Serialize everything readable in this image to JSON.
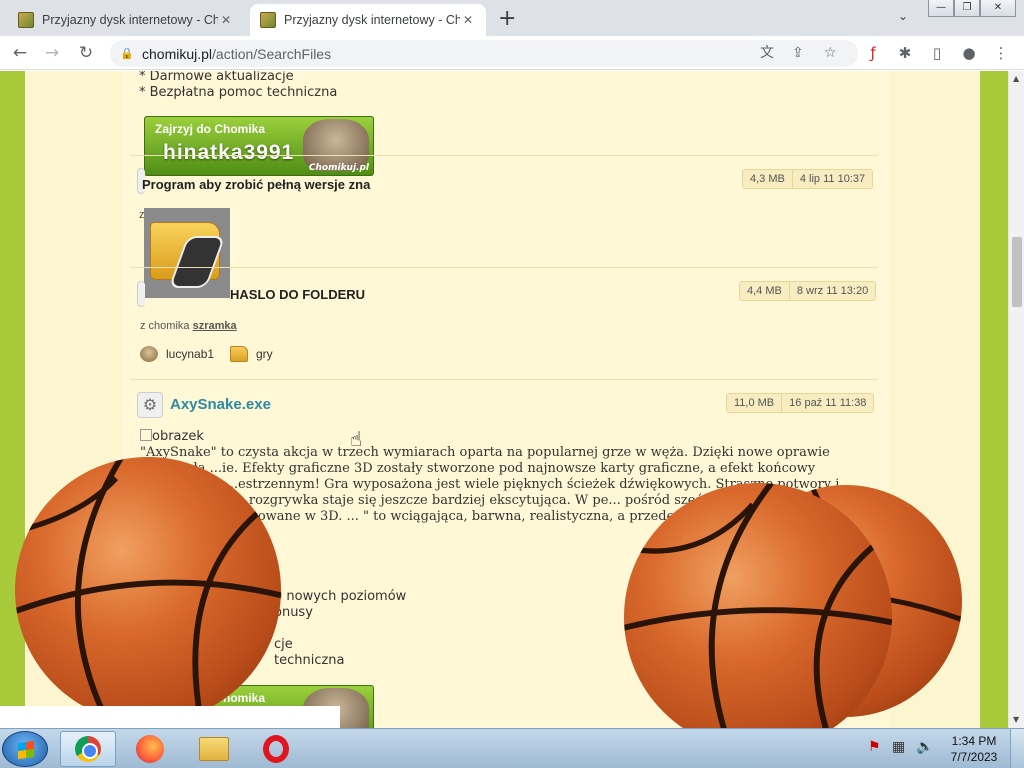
{
  "browser": {
    "tabs": [
      {
        "title": "Przyjazny dysk internetowy - Chomikuj.pl",
        "active": false
      },
      {
        "title": "Przyjazny dysk internetowy - Chomikuj.pl",
        "active": true
      }
    ],
    "new_tab_label": "+",
    "url_host": "chomikuj.pl",
    "url_path": "/action/SearchFiles",
    "window_controls": [
      "minimize",
      "restore",
      "close"
    ]
  },
  "page": {
    "top_lines": [
      "* Darmowe aktualizacje",
      "* Bezpłatna pomoc techniczna"
    ],
    "banner": {
      "line1": "Zajrzyj do Chomika",
      "user": "hinatka3991",
      "brand": "Chomikuj.pl"
    },
    "results": [
      {
        "title": "Program aby zrobić pełną wersje zna",
        "size": "4,3 MB",
        "date": "4 lip 11 10:37"
      },
      {
        "title": "HASLO DO FOLDERU",
        "size": "4,4 MB",
        "date": "8 wrz 11 13:20",
        "from_label": "z chomika",
        "from_user": "szramka",
        "crumb_user": "lucynab1",
        "crumb_folder": "gry"
      },
      {
        "title": "AxySnake.exe",
        "size": "11,0 MB",
        "date": "16 paź 11 11:38",
        "image_alt": "obrazek",
        "description": "\"AxySnake\" to czysta akcja w trzech wymiarach oparta na popularnej grze w węża. Dzięki nowe oprawie otrzymała ...ie. Efekty graficzne 3D zostały stworzone pod najnowsze karty graficzne, a efekt końcowy wzmocniony ...estrzennym! Gra wyposażona jest wiele pięknych ścieżek dźwiękowych. Straszne potwory i ... sy sprawiają, że rozgrywka staje się jeszcze bardziej ekscytująca. W pe... pośród sześciu rodzajów rozgrywki, wszystkie przygotowane w 3D. ... \" to wciągająca, barwna, realistyczna, a przede wszystkim za...",
        "bullets": [
          "0 nowych poziomów",
          "onusy",
          "cje",
          "techniczna"
        ]
      }
    ],
    "z_label": "z"
  },
  "taskbar": {
    "apps": [
      "chrome",
      "firefox",
      "file-explorer",
      "opera"
    ],
    "time": "1:34 PM",
    "date": "7/7/2023"
  },
  "colors": {
    "page_green": "#a7c93a",
    "content_bg": "#fff8d6",
    "link_teal": "#2c8aa3",
    "ball_orange": "#d9692c"
  }
}
